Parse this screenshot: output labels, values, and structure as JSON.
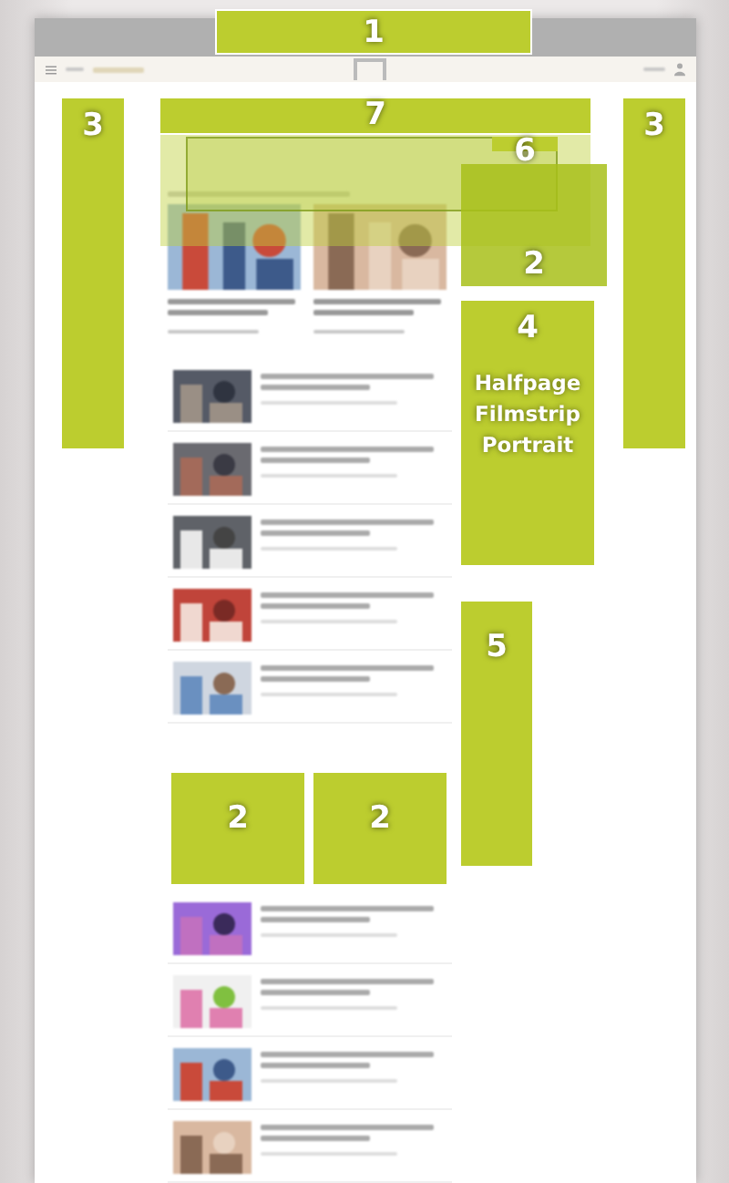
{
  "ad_zones": [
    {
      "number": "1",
      "kind": "solid"
    },
    {
      "number": "3",
      "kind": "solid"
    },
    {
      "number": "7",
      "kind": "solid"
    },
    {
      "number": "6",
      "kind": "solid"
    },
    {
      "number": "2",
      "kind": "translucent"
    },
    {
      "number": "3",
      "kind": "solid"
    },
    {
      "number": "4",
      "kind": "solid",
      "caption": "Halfpage Filmstrip Portrait"
    },
    {
      "number": "5",
      "kind": "solid"
    },
    {
      "number": "2",
      "kind": "solid"
    },
    {
      "number": "2",
      "kind": "solid"
    }
  ]
}
